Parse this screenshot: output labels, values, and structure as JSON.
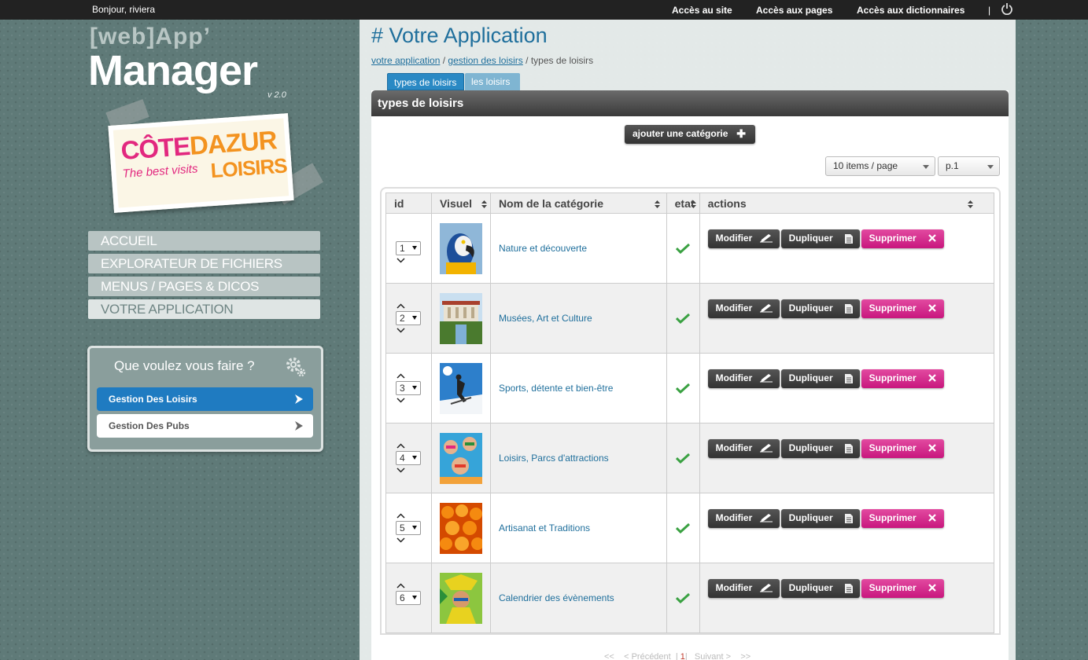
{
  "topbar": {
    "greeting": "Bonjour, riviera",
    "links": [
      "Accès au site",
      "Accès aux pages",
      "Accès aux dictionnaires"
    ],
    "separator": "|",
    "power_icon": "power-icon"
  },
  "logo": {
    "webapp": "[web]App’",
    "manager": "Manager",
    "version": "v 2.0"
  },
  "client_logo": {
    "part1": "CÔTE",
    "part2": "DAZUR",
    "tagline": "The best visits",
    "part3": "LOISIRS"
  },
  "left_menu": {
    "items": [
      {
        "label": "ACCUEIL",
        "active": false
      },
      {
        "label": "EXPLORATEUR DE FICHIERS",
        "active": false
      },
      {
        "label": "MENUS / PAGES & DICOS",
        "active": false
      },
      {
        "label": "VOTRE APPLICATION",
        "active": true
      }
    ]
  },
  "what_box": {
    "title": "Que voulez vous faire ?",
    "icon": "gear-icon",
    "buttons": [
      {
        "label": "Gestion Des Loisirs",
        "active": true
      },
      {
        "label": "Gestion Des Pubs",
        "active": false
      }
    ]
  },
  "main": {
    "title": "# Votre Application",
    "breadcrumb": {
      "link1": "votre application",
      "sep1": " / ",
      "link2": "gestion des loisirs",
      "sep2": " / ",
      "current": "types de loisirs"
    },
    "tabs": [
      "types de loisirs",
      "les loisirs"
    ],
    "section_title": "types de loisirs",
    "add_button": "ajouter une catégorie",
    "per_page": "10 items / page",
    "page_select": "p.1"
  },
  "table": {
    "headers": {
      "id": "id",
      "visual": "Visuel",
      "name": "Nom de la catégorie",
      "state": "etat",
      "actions": "actions"
    },
    "action_labels": {
      "edit": "Modifier",
      "duplicate": "Dupliquer",
      "delete": "Supprimer"
    },
    "rows": [
      {
        "id": "1",
        "name": "Nature et découverte",
        "thumb": "parrot",
        "state": "active"
      },
      {
        "id": "2",
        "name": "Musées, Art et Culture",
        "thumb": "museum",
        "state": "active"
      },
      {
        "id": "3",
        "name": "Sports, détente et bien-être",
        "thumb": "ski",
        "state": "active"
      },
      {
        "id": "4",
        "name": "Loisirs, Parcs d'attractions",
        "thumb": "party",
        "state": "active"
      },
      {
        "id": "5",
        "name": "Artisanat et Traditions",
        "thumb": "oranges",
        "state": "active"
      },
      {
        "id": "6",
        "name": "Calendrier des évènements",
        "thumb": "carnival",
        "state": "active"
      }
    ]
  },
  "pager": {
    "first": "<<",
    "prev": "< Précédent",
    "current": "1",
    "next": "Suivant >",
    "last": ">>"
  },
  "colors": {
    "accent": "#1f6f9c",
    "delete": "#c8177e",
    "active_button": "#1f7bc1",
    "topbar": "#222222"
  }
}
